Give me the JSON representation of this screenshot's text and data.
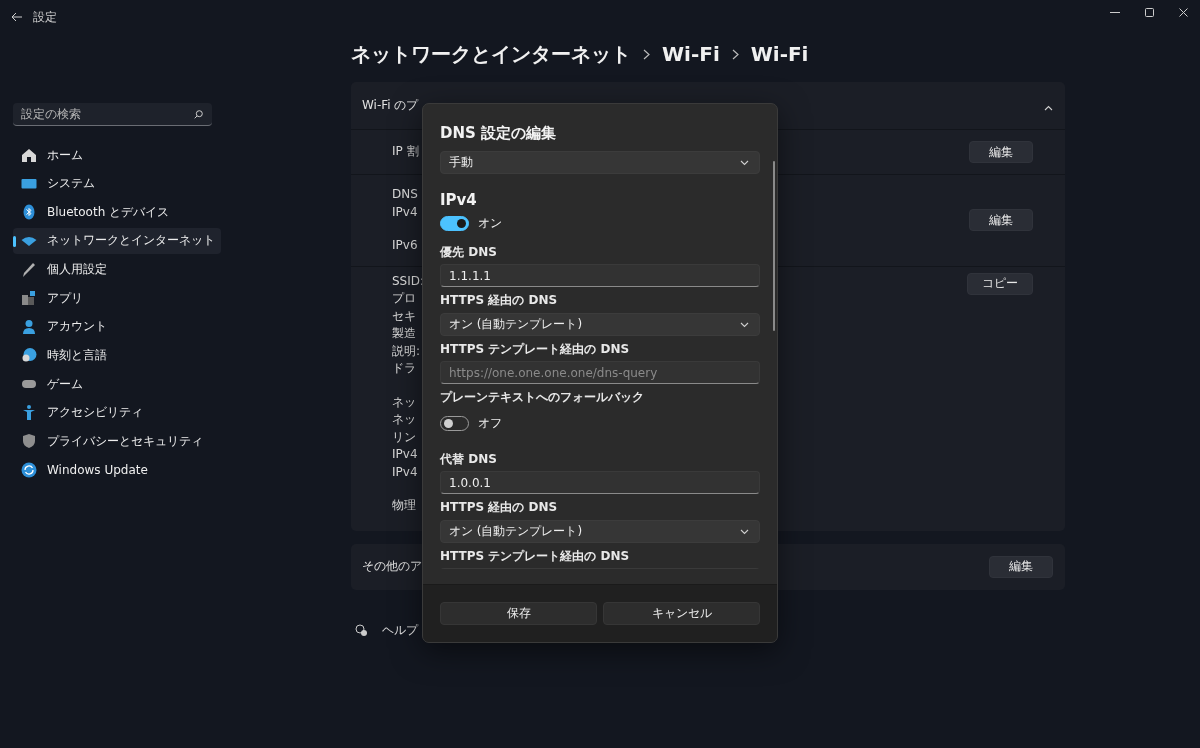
{
  "window": {
    "title": "設定"
  },
  "breadcrumb": [
    "ネットワークとインターネット",
    "Wi-Fi",
    "Wi-Fi"
  ],
  "sidebar": {
    "search": {
      "placeholder": "設定の検索"
    },
    "items": [
      {
        "label": "ホーム",
        "selected": false
      },
      {
        "label": "システム",
        "selected": false
      },
      {
        "label": "Bluetooth とデバイス",
        "selected": false
      },
      {
        "label": "ネットワークとインターネット",
        "selected": true
      },
      {
        "label": "個人用設定",
        "selected": false
      },
      {
        "label": "アプリ",
        "selected": false
      },
      {
        "label": "アカウント",
        "selected": false
      },
      {
        "label": "時刻と言語",
        "selected": false
      },
      {
        "label": "ゲーム",
        "selected": false
      },
      {
        "label": "アクセシビリティ",
        "selected": false
      },
      {
        "label": "プライバシーとセキュリティ",
        "selected": false
      },
      {
        "label": "Windows Update",
        "selected": false
      }
    ]
  },
  "properties_card": {
    "title": "Wi-Fi のプ",
    "expanded": true,
    "rows": [
      {
        "groups": [
          [
            "IP 割"
          ]
        ],
        "button": "編集"
      },
      {
        "groups": [
          [
            "DNS",
            "IPv4"
          ],
          [
            "IPv6"
          ]
        ],
        "button": "編集"
      },
      {
        "groups": [
          [
            "SSID:",
            "プロ",
            "セキ",
            "製造",
            "説明:",
            "ドラ"
          ],
          [
            "ネッ",
            "ネッ",
            "リン",
            "IPv4",
            "IPv4"
          ],
          [
            "物理"
          ]
        ],
        "button": "コピー"
      }
    ]
  },
  "adapter_card": {
    "label": "その他のア",
    "button": "編集"
  },
  "help": {
    "label": "ヘルプ"
  },
  "dialog": {
    "title": "DNS 設定の編集",
    "mode": "手動",
    "items": [
      {
        "kind": "heading",
        "text": "IPv4"
      },
      {
        "kind": "toggle",
        "on": true,
        "label": "オン"
      },
      {
        "kind": "label",
        "text": "優先 DNS"
      },
      {
        "kind": "input",
        "value": "1.1.1.1"
      },
      {
        "kind": "label",
        "text": "HTTPS 経由の DNS"
      },
      {
        "kind": "dropdown",
        "value": "オン (自動テンプレート)"
      },
      {
        "kind": "label",
        "text": "HTTPS テンプレート経由の DNS"
      },
      {
        "kind": "input",
        "placeholder": "https://one.one.one.one/dns-query"
      },
      {
        "kind": "label",
        "text": "プレーンテキストへのフォールバック"
      },
      {
        "kind": "toggle",
        "on": false,
        "label": "オフ"
      },
      {
        "kind": "label",
        "text": "代替 DNS"
      },
      {
        "kind": "input",
        "value": "1.0.0.1"
      },
      {
        "kind": "label",
        "text": "HTTPS 経由の DNS"
      },
      {
        "kind": "dropdown",
        "value": "オン (自動テンプレート)"
      },
      {
        "kind": "label",
        "text": "HTTPS テンプレート経由の DNS"
      },
      {
        "kind": "input"
      }
    ],
    "buttons": [
      "保存",
      "キャンセル"
    ]
  }
}
